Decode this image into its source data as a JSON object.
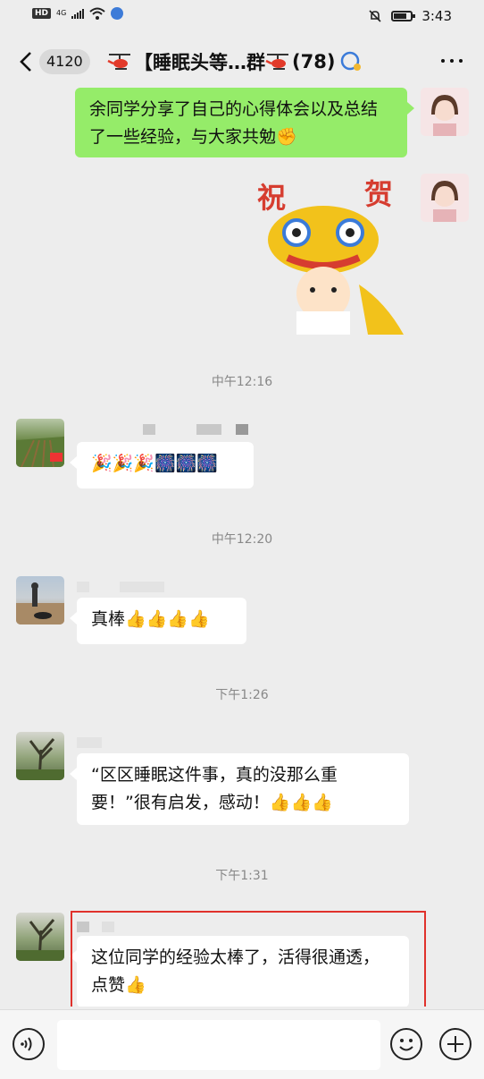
{
  "status_bar": {
    "hd": "HD",
    "network": "4G",
    "time": "3:43"
  },
  "nav": {
    "unread_count": "4120",
    "title_prefix": "【睡眠头等…群",
    "member_count": "(78)"
  },
  "messages": {
    "msg1": "余同学分享了自己的心得体会以及总结了一些经验，与大家共勉✊",
    "ts1": "中午12:16",
    "msg2": "🎉🎉🎉🎆🎆🎆",
    "ts2": "中午12:20",
    "msg3": "真棒👍👍👍👍",
    "ts3": "下午1:26",
    "msg4": "“区区睡眠这件事，真的没那么重要！”很有启发，感动！👍👍👍",
    "ts4": "下午1:31",
    "msg5": "这位同学的经验太棒了，活得很通透，点赞👍"
  },
  "sticker": {
    "left_char": "祝",
    "right_char": "贺"
  },
  "input": {
    "placeholder": ""
  },
  "colors": {
    "background": "#ededed",
    "outgoing_bubble": "#95ec69",
    "incoming_bubble": "#ffffff",
    "highlight_border": "#e0312b"
  },
  "icons": [
    "back-icon",
    "helicopter-icon",
    "chat-bubble-icon",
    "more-icon",
    "voice-icon",
    "emoji-icon",
    "plus-icon",
    "mute-bell-icon",
    "wifi-icon",
    "battery-icon"
  ]
}
